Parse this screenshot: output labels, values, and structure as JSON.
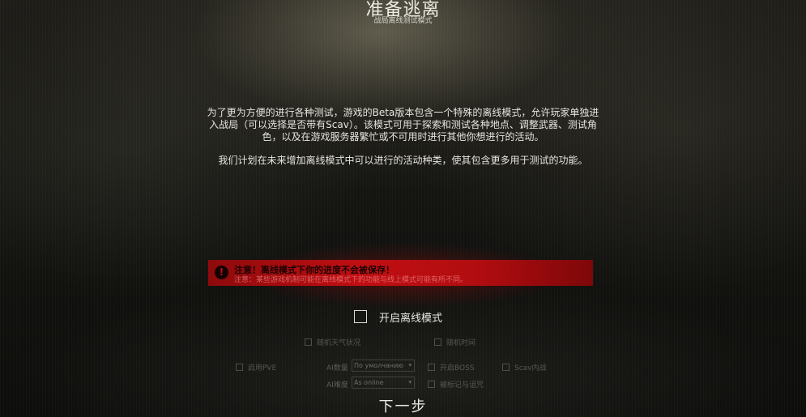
{
  "header": {
    "title": "准备逃离",
    "subtitle": "战局离线测试模式"
  },
  "description": {
    "paragraph1": "为了更为方便的进行各种测试，游戏的Beta版本包含一个特殊的离线模式，允许玩家单独进入战局（可以选择是否带有Scav）。该模式可用于探索和测试各种地点、调整武器、测试角色，以及在游戏服务器繁忙或不可用时进行其他你想进行的活动。",
    "paragraph2": "我们计划在未来增加离线模式中可以进行的活动种类，使其包含更多用于测试的功能。"
  },
  "warning": {
    "icon": "exclamation-icon",
    "title": "注意！离线模式下你的进度不会被保存！",
    "text": "注意：某些游戏机制可能在离线模式下的功能与线上模式可能有所不同。",
    "color": "#c10f13"
  },
  "offline_toggle": {
    "label": "开启离线模式"
  },
  "options": {
    "random_weather": "随机天气状况",
    "random_time": "随机时间",
    "enable_pve": "启用PVE",
    "ai_amount_label": "AI数量",
    "ai_amount_value": "По умолчанию",
    "ai_difficulty_label": "AI难度",
    "ai_difficulty_value": "As online",
    "enable_boss": "开启BOSS",
    "scav_war": "Scav内战",
    "tagged_and_cursed": "被标记与诅咒"
  },
  "footer": {
    "next_label": "下一步"
  }
}
